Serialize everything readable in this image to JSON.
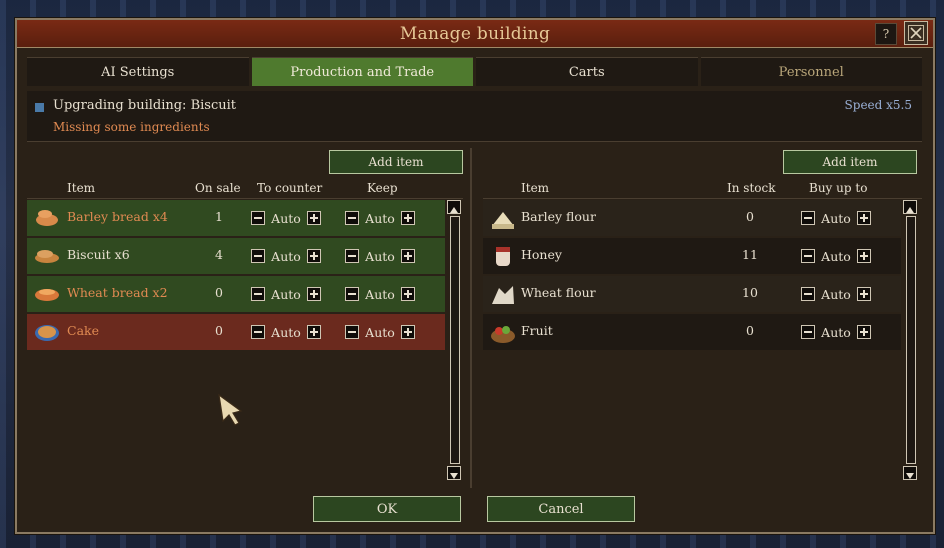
{
  "window": {
    "title": "Manage building",
    "help": "?"
  },
  "tabs": [
    {
      "label": "AI Settings"
    },
    {
      "label": "Production and Trade"
    },
    {
      "label": "Carts"
    },
    {
      "label": "Personnel"
    }
  ],
  "status": {
    "upgrading": "Upgrading building: Biscuit",
    "missing": "Missing some ingredients",
    "speed": "Speed x5.5"
  },
  "sales": {
    "add_label": "Add item",
    "headers": {
      "item": "Item",
      "on_sale": "On sale",
      "to_counter": "To counter",
      "keep": "Keep"
    },
    "rows": [
      {
        "name": "Barley bread  x4",
        "on_sale": "1",
        "to_counter": "Auto",
        "keep": "Auto",
        "icon": "barley-bread-icon"
      },
      {
        "name": "Biscuit  x6",
        "on_sale": "4",
        "to_counter": "Auto",
        "keep": "Auto",
        "icon": "biscuit-icon"
      },
      {
        "name": "Wheat bread  x2",
        "on_sale": "0",
        "to_counter": "Auto",
        "keep": "Auto",
        "icon": "wheat-bread-icon"
      },
      {
        "name": "Cake",
        "on_sale": "0",
        "to_counter": "Auto",
        "keep": "Auto",
        "icon": "cake-icon"
      }
    ]
  },
  "stock": {
    "add_label": "Add item",
    "headers": {
      "item": "Item",
      "in_stock": "In stock",
      "buy_up_to": "Buy up to"
    },
    "rows": [
      {
        "name": "Barley flour",
        "in_stock": "0",
        "buy_up_to": "Auto",
        "icon": "barley-flour-icon"
      },
      {
        "name": "Honey",
        "in_stock": "11",
        "buy_up_to": "Auto",
        "icon": "honey-icon"
      },
      {
        "name": "Wheat flour",
        "in_stock": "10",
        "buy_up_to": "Auto",
        "icon": "wheat-flour-icon"
      },
      {
        "name": "Fruit",
        "in_stock": "0",
        "buy_up_to": "Auto",
        "icon": "fruit-icon"
      }
    ]
  },
  "footer": {
    "ok": "OK",
    "cancel": "Cancel"
  },
  "colors": {
    "accent_green": "#4f7a2e",
    "title_red": "#7a2a14",
    "warning_orange": "#e08a52",
    "speed_blue": "#9ab0d6"
  }
}
